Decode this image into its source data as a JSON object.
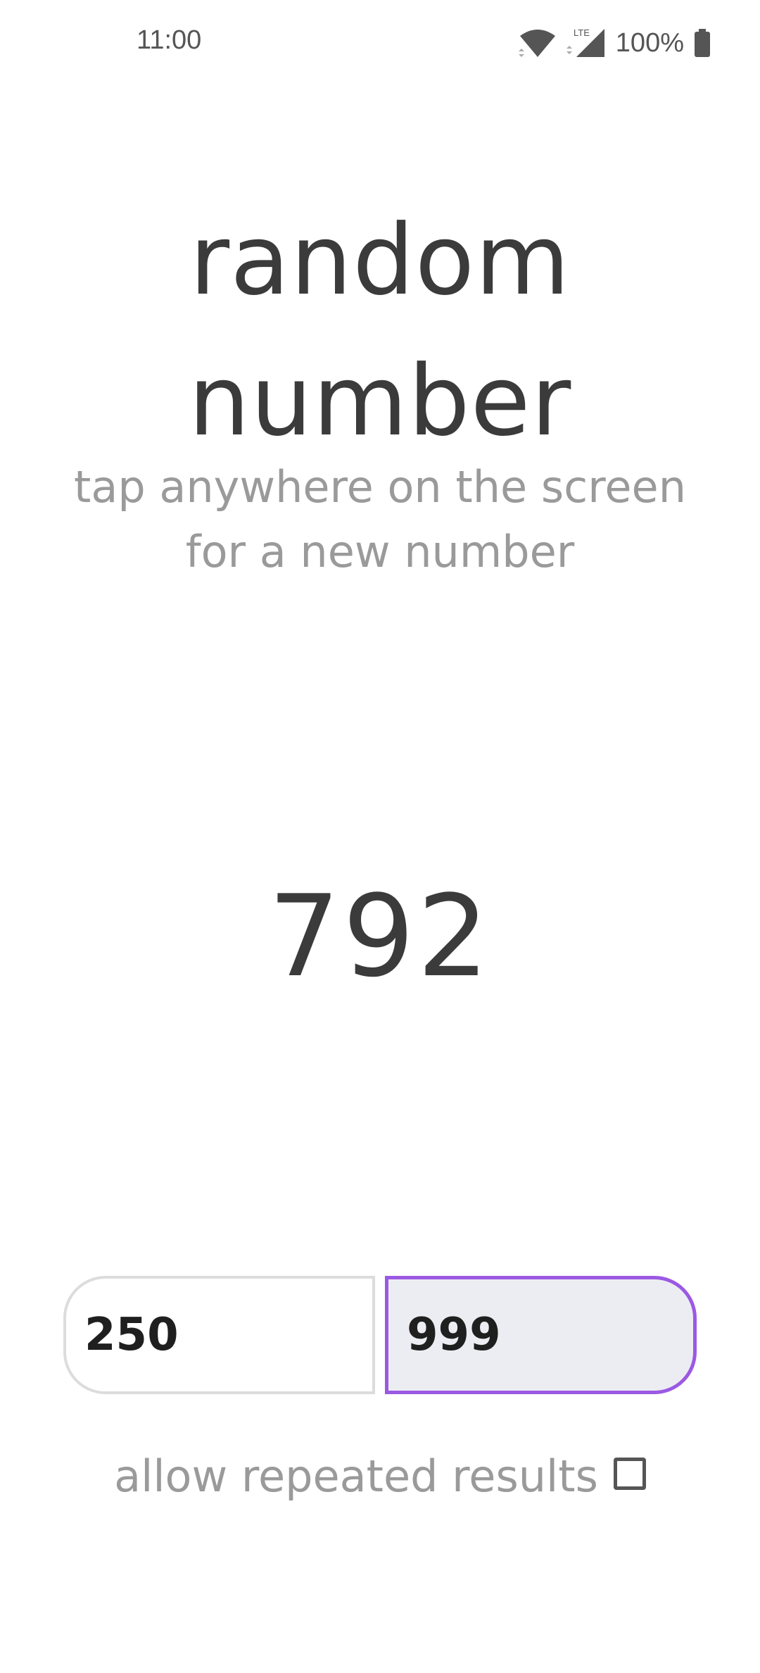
{
  "status_bar": {
    "time": "11:00",
    "network_label": "LTE",
    "battery_percent": "100%",
    "icons": [
      "wifi-icon",
      "signal-icon",
      "battery-icon"
    ]
  },
  "header": {
    "title_line1": "random",
    "title_line2": "number",
    "subtitle_line1": "tap anywhere on the screen",
    "subtitle_line2": "for a new number"
  },
  "result": {
    "value": "792"
  },
  "range": {
    "min_value": "250",
    "max_value": "999"
  },
  "options": {
    "allow_repeated_label": "allow repeated results",
    "allow_repeated_checked": false
  },
  "colors": {
    "accent": "#9b59e3",
    "text_dark": "#3b3b3b",
    "text_muted": "#9a9a9a",
    "input_active_bg": "#ecedf2"
  }
}
